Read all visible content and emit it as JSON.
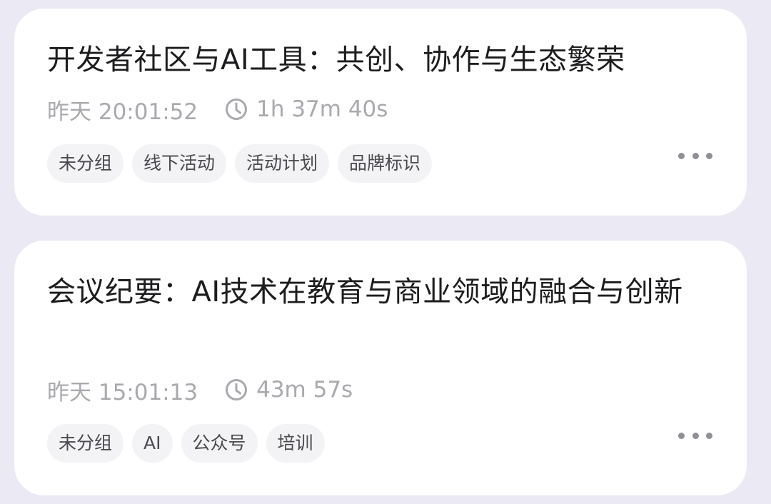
{
  "recordings": [
    {
      "title": "开发者社区与AI工具：共创、协作与生态繁荣",
      "date": "昨天 20:01:52",
      "duration": "1h 37m 40s",
      "tags": [
        "未分组",
        "线下活动",
        "活动计划",
        "品牌标识"
      ]
    },
    {
      "title": "会议纪要：AI技术在教育与商业领域的融合与创新",
      "date": "昨天 15:01:13",
      "duration": "43m 57s",
      "tags": [
        "未分组",
        "AI",
        "公众号",
        "培训"
      ]
    }
  ],
  "icons": {
    "duration": "clock-icon",
    "more": "more-dots-icon"
  },
  "colors": {
    "background": "#ebe9f4",
    "card": "#ffffff",
    "title": "#1d1d1f",
    "meta": "#a9a9ae",
    "tag_bg": "#f3f3f5",
    "tag_text": "#4a4a4f"
  }
}
